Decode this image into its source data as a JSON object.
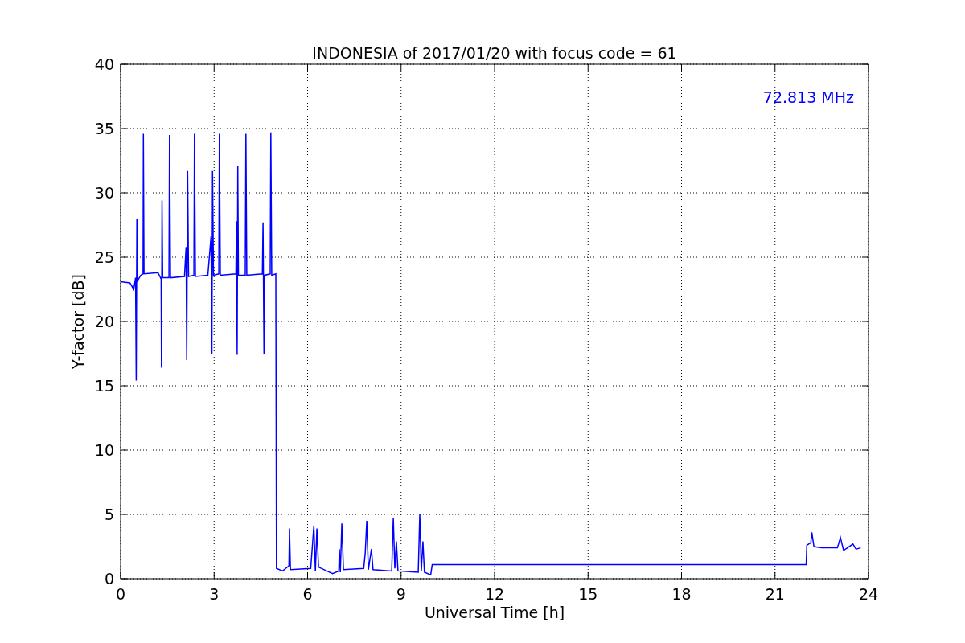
{
  "figure": {
    "chart_data": {
      "type": "line",
      "title": "INDONESIA of 2017/01/20 with focus code = 61",
      "xlabel": "Universal Time [h]",
      "ylabel": "Y-factor [dB]",
      "xlim": [
        0,
        24
      ],
      "ylim": [
        0,
        40
      ],
      "xticks": [
        0,
        3,
        6,
        9,
        12,
        15,
        18,
        21,
        24
      ],
      "yticks": [
        0,
        5,
        10,
        15,
        20,
        25,
        30,
        35,
        40
      ],
      "x": [
        0.0,
        0.3,
        0.42,
        0.48,
        0.5,
        0.52,
        0.55,
        0.65,
        0.72,
        0.73,
        0.75,
        1.2,
        1.3,
        1.31,
        1.33,
        1.35,
        1.55,
        1.57,
        1.6,
        2.05,
        2.1,
        2.12,
        2.15,
        2.18,
        2.35,
        2.37,
        2.4,
        2.8,
        2.9,
        2.93,
        2.95,
        2.98,
        3.15,
        3.17,
        3.2,
        3.7,
        3.72,
        3.74,
        3.76,
        3.78,
        4.0,
        4.02,
        4.05,
        4.55,
        4.57,
        4.6,
        4.62,
        4.8,
        4.82,
        4.85,
        4.98,
        5.0,
        5.2,
        5.4,
        5.42,
        5.45,
        6.1,
        6.2,
        6.25,
        6.3,
        6.35,
        6.8,
        7.0,
        7.02,
        7.05,
        7.1,
        7.15,
        7.8,
        7.85,
        7.9,
        7.95,
        8.05,
        8.1,
        8.7,
        8.75,
        8.8,
        8.85,
        8.9,
        9.55,
        9.6,
        9.65,
        9.7,
        9.75,
        9.95,
        10.0,
        22.0,
        22.02,
        22.15,
        22.18,
        22.25,
        22.5,
        23.0,
        23.1,
        23.2,
        23.5,
        23.6,
        23.75
      ],
      "series": [
        {
          "name": "72.813 MHz",
          "color": "#0000ff",
          "values": [
            23.1,
            23.0,
            22.5,
            23.4,
            15.4,
            28.0,
            23.2,
            23.6,
            23.7,
            34.6,
            23.7,
            23.8,
            23.3,
            16.4,
            29.4,
            23.4,
            23.4,
            34.5,
            23.4,
            23.5,
            25.8,
            17.0,
            31.7,
            23.5,
            23.6,
            34.6,
            23.5,
            23.6,
            26.6,
            17.5,
            31.7,
            23.6,
            23.7,
            34.6,
            23.6,
            23.7,
            27.8,
            17.4,
            32.1,
            23.6,
            23.6,
            34.6,
            23.6,
            23.7,
            27.7,
            17.5,
            23.6,
            23.7,
            34.7,
            23.6,
            23.7,
            0.8,
            0.6,
            1.0,
            3.9,
            0.7,
            0.8,
            4.1,
            0.6,
            3.9,
            0.9,
            0.4,
            0.6,
            2.3,
            0.5,
            4.3,
            0.7,
            0.8,
            2.0,
            4.5,
            0.7,
            2.3,
            0.7,
            0.6,
            4.7,
            0.8,
            2.9,
            0.6,
            0.5,
            5.0,
            0.6,
            2.9,
            0.5,
            0.3,
            1.1,
            1.1,
            2.6,
            2.8,
            3.6,
            2.5,
            2.4,
            2.4,
            3.2,
            2.2,
            2.7,
            2.3,
            2.4
          ]
        }
      ],
      "grid": true
    }
  }
}
